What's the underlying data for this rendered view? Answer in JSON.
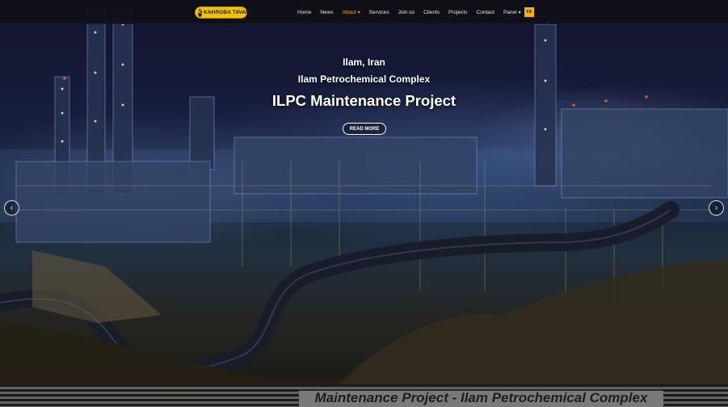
{
  "header": {
    "logo_text": "KAHROBA TAVAN",
    "nav": [
      {
        "label": "Home"
      },
      {
        "label": "News"
      },
      {
        "label": "About",
        "dropdown": true,
        "active": true
      },
      {
        "label": "Services"
      },
      {
        "label": "Join us"
      },
      {
        "label": "Clients"
      },
      {
        "label": "Projects"
      },
      {
        "label": "Contact"
      },
      {
        "label": "Panel",
        "dropdown": true
      }
    ],
    "lang_label": "FA"
  },
  "slide": {
    "location": "Ilam, Iran",
    "subtitle": "Ilam Petrochemical Complex",
    "title": "ILPC Maintenance Project",
    "button": "READ MORE"
  },
  "slider": {
    "prev_icon": "chevron-left-icon",
    "next_icon": "chevron-right-icon"
  },
  "banner": {
    "text": "Maintenance Project - Ilam Petrochemical Complex"
  },
  "colors": {
    "accent": "#f2b200",
    "navbar": "#0f0f16"
  }
}
